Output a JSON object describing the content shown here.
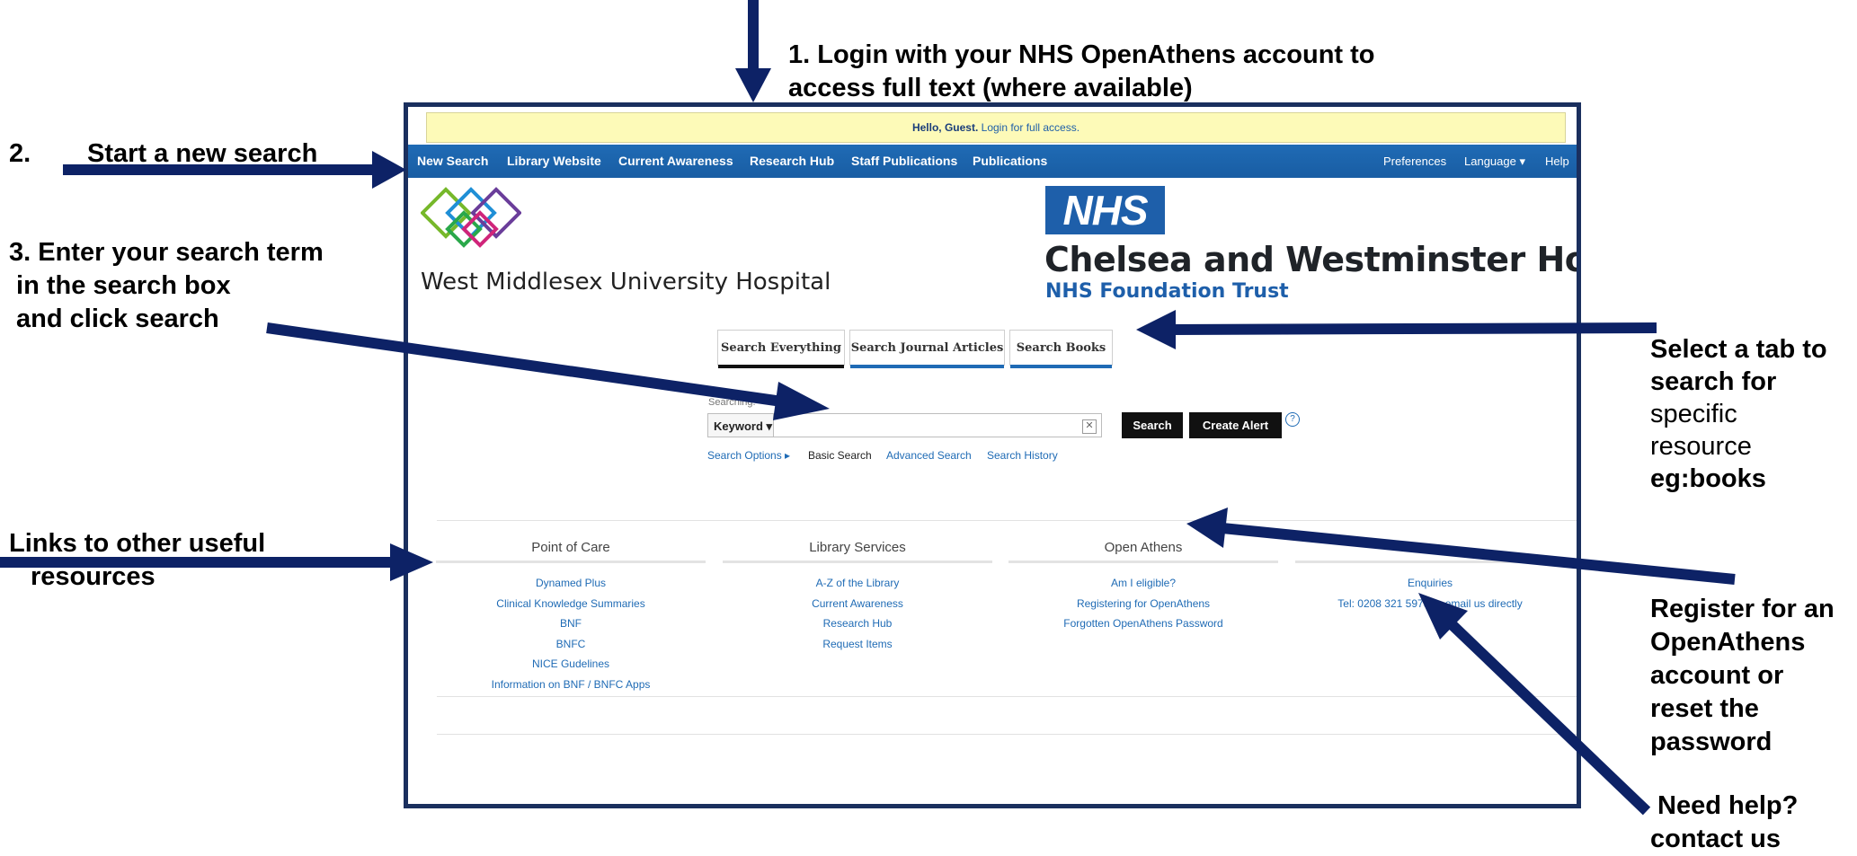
{
  "annotations": {
    "step1_line1": "1.  Login with your NHS OpenAthens account to",
    "step1_line2": "access full text (where available)",
    "step2_num": "2.",
    "step2_text": "Start a new search",
    "step3_line1": "3. Enter your search term",
    "step3_line2": " in the search box",
    "step3_line3": " and click search",
    "links_line1": "Links to other useful",
    "links_line2": "resources",
    "tab_line1": "Select a tab to",
    "tab_line2": "search for",
    "tab_line3": "specific",
    "tab_line4": "resource",
    "tab_line5": "eg:books",
    "register_line1": "Register for an",
    "register_line2": "OpenAthens",
    "register_line3": "account or",
    "register_line4": "reset the",
    "register_line5": "password",
    "help_line1": " Need help?",
    "help_line2": "contact us"
  },
  "guest_bar": {
    "greeting": "Hello, Guest.",
    "login_link": "Login for full access."
  },
  "nav": {
    "left": [
      "New Search",
      "Library Website",
      "Current Awareness",
      "Research Hub",
      "Staff Publications",
      "Publications"
    ],
    "right": [
      "Preferences",
      "Language ▾",
      "Help"
    ]
  },
  "branding": {
    "left_name": "West Middlesex University Hospital",
    "nhs_logo": "NHS",
    "right_name": "Chelsea and Westminster Hospital",
    "right_trust": "NHS Foundation Trust"
  },
  "tabs": [
    "Search Everything",
    "Search Journal Articles",
    "Search Books"
  ],
  "search": {
    "searching_label": "Searching:",
    "field_select": "Keyword ▾",
    "input_value": "",
    "input_placeholder": "",
    "clear": "✕",
    "search_button": "Search",
    "alert_button": "Create Alert",
    "help": "?",
    "options": "Search Options ▸",
    "basic": "Basic Search",
    "advanced": "Advanced Search",
    "history": "Search History"
  },
  "columns": [
    {
      "title": "Point of Care",
      "links": [
        "Dynamed Plus",
        "Clinical Knowledge Summaries",
        "BNF",
        "BNFC",
        "NICE Gudelines",
        "Information on BNF / BNFC Apps"
      ]
    },
    {
      "title": "Library Services",
      "links": [
        "A-Z of the Library",
        "Current Awareness",
        "Research Hub",
        "Request Items"
      ]
    },
    {
      "title": "Open Athens",
      "links": [
        "Am I eligible?",
        "Registering for OpenAthens",
        "Forgotten OpenAthens Password"
      ]
    },
    {
      "title": "",
      "links": [
        "Enquiries",
        "Tel: 0208 321 5979 or email us directly"
      ]
    }
  ],
  "colors": {
    "nav_blue": "#1f6bb5",
    "frame_navy": "#1a2f5e",
    "arrow_navy": "#0d2266",
    "nhs_blue": "#1e5faa",
    "guest_yellow": "#fdfab8"
  }
}
